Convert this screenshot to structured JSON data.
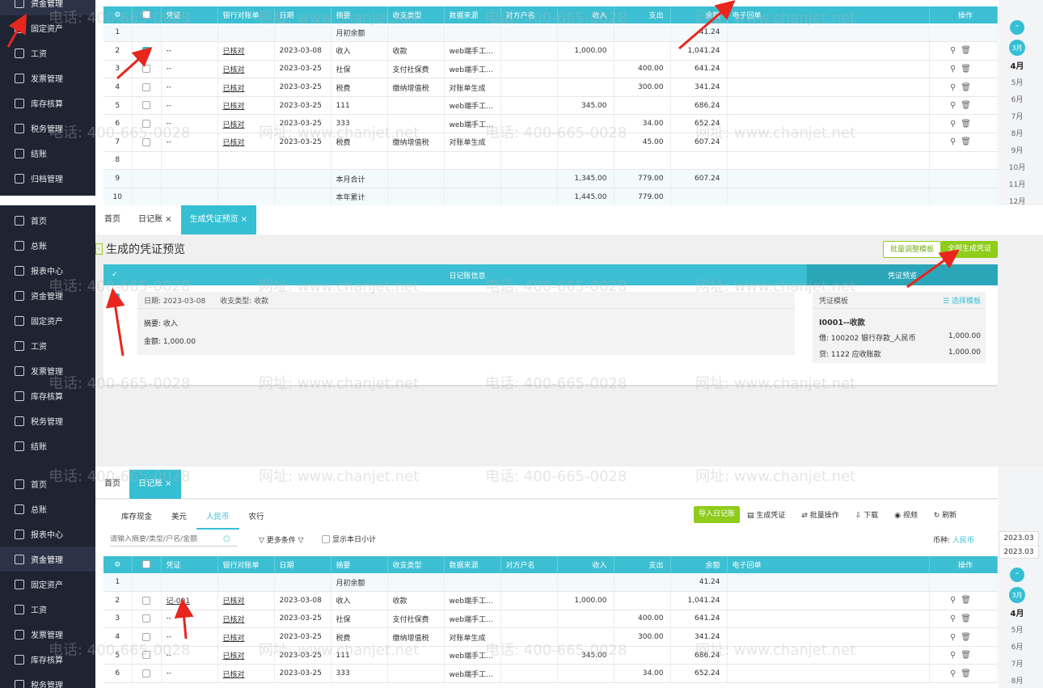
{
  "nav": {
    "top": [
      "资金管理",
      "固定资产",
      "工资",
      "发票管理",
      "库存核算",
      "税务管理",
      "结账",
      "归档管理"
    ],
    "full": [
      "首页",
      "总账",
      "报表中心",
      "资金管理",
      "固定资产",
      "工资",
      "发票管理",
      "库存核算",
      "税务管理",
      "结账"
    ],
    "bottom": [
      "首页",
      "总账",
      "报表中心",
      "资金管理",
      "固定资产",
      "工资",
      "发票管理",
      "库存核算",
      "税务管理"
    ]
  },
  "months": {
    "top": [
      "3月",
      "4月",
      "5月",
      "6月",
      "7月",
      "8月",
      "9月",
      "10月",
      "11月",
      "12月"
    ],
    "bottom": [
      "3月",
      "4月",
      "5月",
      "6月",
      "7月",
      "8月"
    ],
    "year_dropdown": [
      "2023.03",
      "2023.03"
    ]
  },
  "ledger": {
    "headers": [
      "凭证",
      "银行对账单",
      "日期",
      "摘要",
      "收支类型",
      "数据来源",
      "对方户名",
      "收入",
      "支出",
      "余额",
      "电子回单",
      "操作"
    ],
    "rows_top": [
      [
        "1",
        "",
        "",
        "",
        "",
        "月初余额",
        "",
        "",
        "",
        "",
        "",
        "41.24"
      ],
      [
        "2",
        "on",
        "--",
        "已核对",
        "2023-03-08",
        "收入",
        "收款",
        "web端手工...",
        "",
        "1,000.00",
        "",
        "1,041.24"
      ],
      [
        "3",
        "",
        "--",
        "已核对",
        "2023-03-25",
        "社保",
        "支付社保费",
        "web端手工...",
        "",
        "",
        "400.00",
        "641.24"
      ],
      [
        "4",
        "",
        "--",
        "已核对",
        "2023-03-25",
        "税费",
        "缴纳增值税",
        "对账单生成",
        "",
        "",
        "300.00",
        "341.24"
      ],
      [
        "5",
        "",
        "--",
        "已核对",
        "2023-03-25",
        "111",
        "",
        "web端手工...",
        "",
        "345.00",
        "",
        "686.24"
      ],
      [
        "6",
        "",
        "--",
        "已核对",
        "2023-03-25",
        "333",
        "",
        "web端手工...",
        "",
        "",
        "34.00",
        "652.24"
      ],
      [
        "7",
        "",
        "--",
        "已核对",
        "2023-03-25",
        "税费",
        "缴纳增值税",
        "对账单生成",
        "",
        "",
        "45.00",
        "607.24"
      ],
      [
        "8",
        "",
        "",
        "",
        "",
        "",
        "",
        "",
        "",
        "",
        "",
        ""
      ],
      [
        "9",
        "",
        "",
        "",
        "",
        "本月合计",
        "",
        "",
        "",
        "1,345.00",
        "779.00",
        "607.24"
      ],
      [
        "10",
        "",
        "",
        "",
        "",
        "本年累计",
        "",
        "",
        "",
        "1,445.00",
        "779.00",
        ""
      ]
    ],
    "rows_bottom": [
      [
        "1",
        "",
        "",
        "",
        "",
        "月初余额",
        "",
        "",
        "",
        "",
        "",
        "41.24"
      ],
      [
        "2",
        "",
        "记-001",
        "已核对",
        "2023-03-08",
        "收入",
        "收款",
        "web端手工...",
        "",
        "1,000.00",
        "",
        "1,041.24"
      ],
      [
        "3",
        "",
        "--",
        "已核对",
        "2023-03-25",
        "社保",
        "支付社保费",
        "web端手工...",
        "",
        "",
        "400.00",
        "641.24"
      ],
      [
        "4",
        "",
        "--",
        "已核对",
        "2023-03-25",
        "税费",
        "缴纳增值税",
        "对账单生成",
        "",
        "",
        "300.00",
        "341.24"
      ],
      [
        "5",
        "",
        "--",
        "已核对",
        "2023-03-25",
        "111",
        "",
        "web端手工...",
        "",
        "345.00",
        "",
        "686.24"
      ],
      [
        "6",
        "",
        "--",
        "已核对",
        "2023-03-25",
        "333",
        "",
        "web端手工...",
        "",
        "",
        "34.00",
        "652.24"
      ]
    ]
  },
  "preview": {
    "tabs": [
      "首页",
      "日记账 ×",
      "生成凭证预览 ×"
    ],
    "title": "生成的凭证预览",
    "btn_batch": "批量调整模板",
    "btn_all": "全部生成凭证",
    "head_left": "日记账信息",
    "head_right": "凭证预览",
    "check_mark": "✓",
    "date": "日期: 2023-03-08",
    "type": "收支类型: 收款",
    "summary": "摘要: 收入",
    "amount": "金额: 1,000.00",
    "template_label": "凭证模板",
    "select_template": "☰ 选择模板",
    "voucher_title": "I0001--收款",
    "debit": "借:   100202 银行存款_人民币",
    "debit_amt": "1,000.00",
    "credit": "贷:   1122 应收账款",
    "credit_amt": "1,000.00"
  },
  "journal": {
    "tabs": [
      "首页",
      "日记账 ×"
    ],
    "currency_tabs": [
      "库存现金",
      "美元",
      "人民币",
      "农行"
    ],
    "btn_import": "导入日记账",
    "toolbar": [
      "▤ 生成凭证",
      "⇄ 批量操作",
      "⇩ 下载",
      "◉ 视频",
      "↻ 刷新"
    ],
    "search_placeholder": "请输入摘要/类型/户名/金额",
    "more": "▽ 更多条件 ▽",
    "show_subtotal": "显示本日小计",
    "currency_label": "币种:",
    "currency_value": "人民币"
  },
  "watermark": [
    "电话: 400-665-0028",
    "网址: www.chanjet.net"
  ]
}
